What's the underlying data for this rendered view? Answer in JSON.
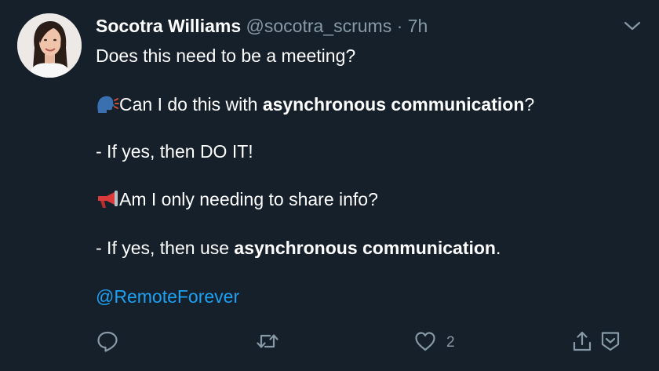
{
  "tweet": {
    "author": {
      "display_name": "Socotra Williams",
      "handle": "@socotra_scrums",
      "separator": "·",
      "timestamp": "7h"
    },
    "lines": [
      {
        "text": "Does this need to be a meeting?"
      },
      {
        "icon": "speaking-head-emoji",
        "before": "Can I do this with ",
        "bold": "asynchronous communication",
        "after": "?"
      },
      {
        "text": "- If yes, then DO IT!"
      },
      {
        "icon": "megaphone-emoji",
        "text": "Am I only needing to share info?"
      },
      {
        "before": "- If yes, then use ",
        "bold": "asynchronous communication",
        "after": "."
      }
    ],
    "mention": "@RemoteForever",
    "actions": {
      "reply_icon": "reply-icon",
      "retweet_icon": "retweet-icon",
      "like_icon": "heart-icon",
      "like_count": "2",
      "share_icon": "share-icon",
      "save_icon": "save-icon",
      "menu_icon": "chevron-down-icon"
    }
  },
  "colors": {
    "background": "#15202b",
    "text": "#ffffff",
    "secondary": "#8899a6",
    "link": "#1da1f2"
  }
}
